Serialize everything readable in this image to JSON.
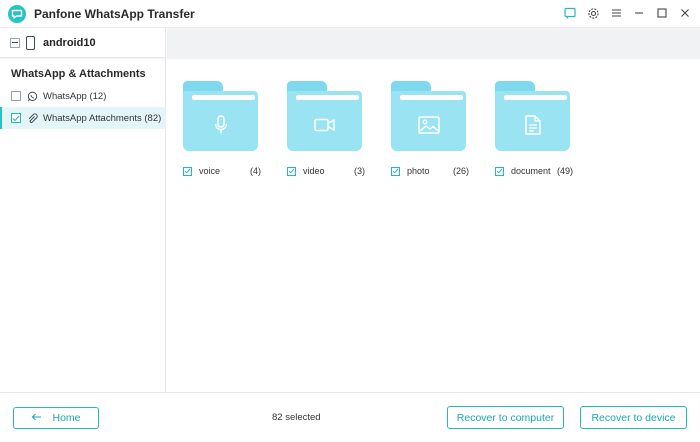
{
  "app": {
    "title": "Panfone WhatsApp Transfer",
    "accent": "#25c2c8"
  },
  "window_controls": [
    "feedback-icon",
    "settings-icon",
    "menu-icon",
    "minimize-icon",
    "maximize-icon",
    "close-icon"
  ],
  "sidebar": {
    "device": {
      "name": "android10",
      "checkbox": "partial"
    },
    "section_title": "WhatsApp & Attachments",
    "items": [
      {
        "label": "WhatsApp (12)",
        "icon": "whatsapp-icon",
        "checked": false,
        "active": false
      },
      {
        "label": "WhatsApp Attachments (82)",
        "icon": "paperclip-icon",
        "checked": true,
        "active": true
      }
    ]
  },
  "folders": [
    {
      "name": "voice",
      "count": "(4)",
      "icon": "microphone-icon",
      "checked": true
    },
    {
      "name": "video",
      "count": "(3)",
      "icon": "video-camera-icon",
      "checked": true
    },
    {
      "name": "photo",
      "count": "(26)",
      "icon": "image-icon",
      "checked": true
    },
    {
      "name": "document",
      "count": "(49)",
      "icon": "document-icon",
      "checked": true
    }
  ],
  "footer": {
    "home_label": "Home",
    "selected_text": "82 selected",
    "recover_computer_label": "Recover to computer",
    "recover_device_label": "Recover to device"
  }
}
